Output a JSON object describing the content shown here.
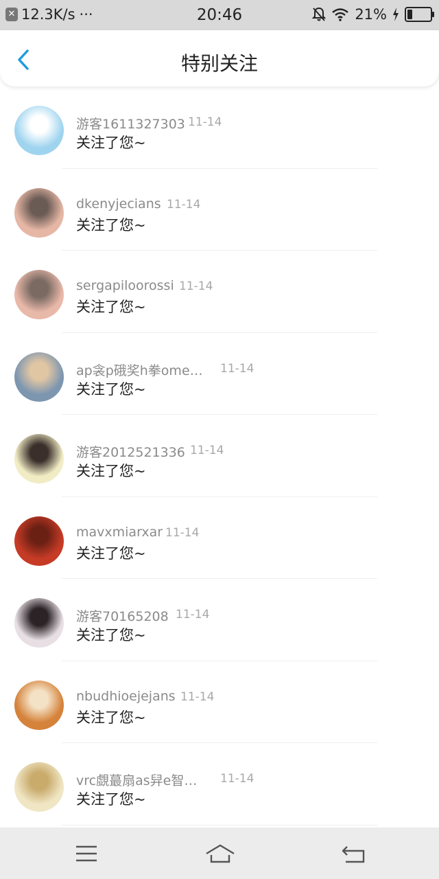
{
  "status_bar": {
    "speed": "12.3K/s",
    "dots": "···",
    "time": "20:46",
    "battery_text": "21%",
    "battery_level": 0.21
  },
  "header": {
    "title": "特别关注",
    "back_icon": "chevron-left-icon"
  },
  "list": [
    {
      "name": "游客1611327303",
      "date": "11-14",
      "message": "关注了您~",
      "avatar_colors": [
        "#9fd4ef",
        "#ffffff"
      ]
    },
    {
      "name": "dkenyjecians",
      "date": "11-14",
      "message": "关注了您~",
      "avatar_colors": [
        "#e6b7a5",
        "#6b5b55"
      ]
    },
    {
      "name": "sergapiloorossi",
      "date": "11-14",
      "message": "关注了您~",
      "avatar_colors": [
        "#e8b8a9",
        "#7a6a62"
      ]
    },
    {
      "name": "ap衾p硪奖h拳ome…",
      "date": "11-14",
      "message": "关注了您~",
      "avatar_colors": [
        "#7d96b0",
        "#e1c6a3"
      ]
    },
    {
      "name": "游客2012521336",
      "date": "11-14",
      "message": "关注了您~",
      "avatar_colors": [
        "#f1ecc4",
        "#3a2f2b"
      ]
    },
    {
      "name": "mavxmiarxar",
      "date": "11-14",
      "message": "关注了您~",
      "avatar_colors": [
        "#c63b26",
        "#6b2014"
      ]
    },
    {
      "name": "游客70165208",
      "date": "11-14",
      "message": "关注了您~",
      "avatar_colors": [
        "#e8dfe4",
        "#2b2326"
      ]
    },
    {
      "name": "nbudhioejejans",
      "date": "11-14",
      "message": "关注了您~",
      "avatar_colors": [
        "#d5823a",
        "#f4e2c6"
      ]
    },
    {
      "name": "vrc覷蕞扇as舁e智…",
      "date": "11-14",
      "message": "关注了您~",
      "avatar_colors": [
        "#f0e6c4",
        "#c9ab6c"
      ]
    }
  ],
  "nav_bar": {
    "menu_icon": "menu-icon",
    "home_icon": "home-icon",
    "back_icon": "return-icon"
  },
  "colors": {
    "accent": "#1e9ce0",
    "status_bar_bg": "#d9d9d9",
    "nav_bar_bg": "#ececec"
  }
}
